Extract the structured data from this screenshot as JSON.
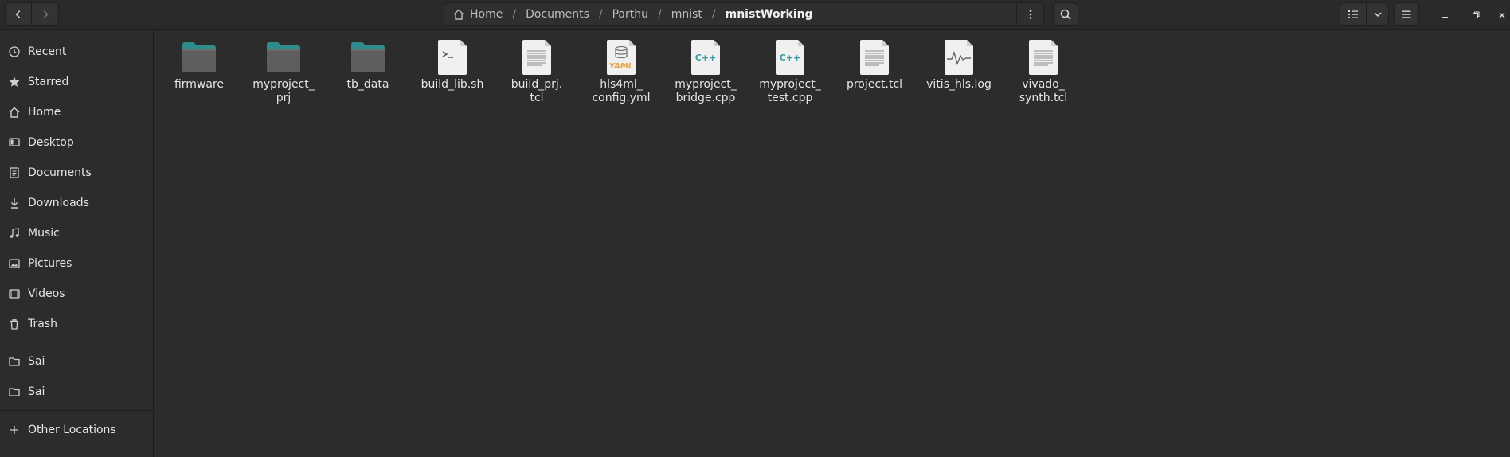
{
  "window": {
    "title": "mnistWorking"
  },
  "pathbar": {
    "crumbs": [
      {
        "label": "Home"
      },
      {
        "label": "Documents"
      },
      {
        "label": "Parthu"
      },
      {
        "label": "mnist"
      },
      {
        "label": "mnistWorking"
      }
    ]
  },
  "sidebar": {
    "items": [
      {
        "label": "Recent",
        "icon": "clock-icon"
      },
      {
        "label": "Starred",
        "icon": "star-icon"
      },
      {
        "label": "Home",
        "icon": "home-icon"
      },
      {
        "label": "Desktop",
        "icon": "desktop-icon"
      },
      {
        "label": "Documents",
        "icon": "document-icon"
      },
      {
        "label": "Downloads",
        "icon": "download-icon"
      },
      {
        "label": "Music",
        "icon": "music-icon"
      },
      {
        "label": "Pictures",
        "icon": "picture-icon"
      },
      {
        "label": "Videos",
        "icon": "video-icon"
      },
      {
        "label": "Trash",
        "icon": "trash-icon"
      },
      {
        "label": "Sai",
        "icon": "folder-icon"
      },
      {
        "label": "Sai",
        "icon": "folder-icon"
      },
      {
        "label": "Other Locations",
        "icon": "plus-icon"
      }
    ]
  },
  "files": [
    {
      "line1": "firmware",
      "line2": "",
      "type": "folder"
    },
    {
      "line1": "myproject_",
      "line2": "prj",
      "type": "folder"
    },
    {
      "line1": "tb_data",
      "line2": "",
      "type": "folder"
    },
    {
      "line1": "build_lib.sh",
      "line2": "",
      "type": "script"
    },
    {
      "line1": "build_prj.",
      "line2": "tcl",
      "type": "text"
    },
    {
      "line1": "hls4ml_",
      "line2": "config.yml",
      "type": "yaml",
      "badge": "YAML"
    },
    {
      "line1": "myproject_",
      "line2": "bridge.cpp",
      "type": "cpp",
      "badge": "C++"
    },
    {
      "line1": "myproject_",
      "line2": "test.cpp",
      "type": "cpp",
      "badge": "C++"
    },
    {
      "line1": "project.tcl",
      "line2": "",
      "type": "text"
    },
    {
      "line1": "vitis_hls.log",
      "line2": "",
      "type": "log"
    },
    {
      "line1": "vivado_",
      "line2": "synth.tcl",
      "type": "text"
    }
  ],
  "colors": {
    "accent_folder": "#2f8c8c",
    "cpp_text": "#3a9aa3",
    "yaml_text": "#e8a33d"
  }
}
